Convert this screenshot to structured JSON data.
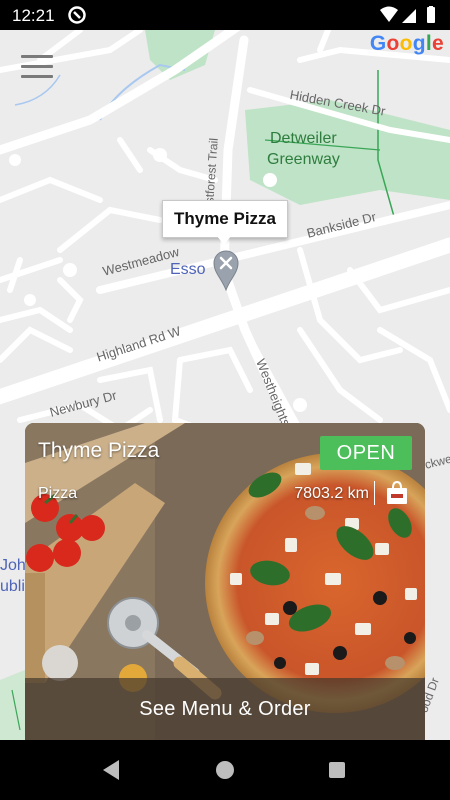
{
  "status_bar": {
    "time": "12:21"
  },
  "map": {
    "attribution": "Google",
    "attribution_colors": [
      "#4285F4",
      "#EA4335",
      "#FBBC05",
      "#4285F4",
      "#34A853",
      "#EA4335"
    ],
    "labels": {
      "hidden_creek": "Hidden Creek Dr",
      "detweiler_1": "Detweiler",
      "detweiler_2": "Greenway",
      "westforest": "Westforest Trail",
      "bankside": "Bankside Dr",
      "westmeadow": "Westmeadow",
      "highland": "Highland Rd W",
      "westheights": "Westheights Dr",
      "newbury": "Newbury Dr",
      "joh": "Joh",
      "ubli": "ubli",
      "wood": "ood Dr",
      "ckwell": "ckwell"
    },
    "poi": "Esso",
    "marker_callout": "Thyme Pizza"
  },
  "card": {
    "name": "Thyme Pizza",
    "status": "OPEN",
    "category": "Pizza",
    "distance": "7803.2 km",
    "cta": "See Menu & Order",
    "status_color": "#4CBF5A"
  },
  "icons": {
    "menu": "hamburger-menu-icon",
    "pin": "map-pin-icon",
    "bag": "shopping-bag-icon",
    "back": "nav-back-icon",
    "home": "nav-home-icon",
    "recent": "nav-recent-icon"
  }
}
